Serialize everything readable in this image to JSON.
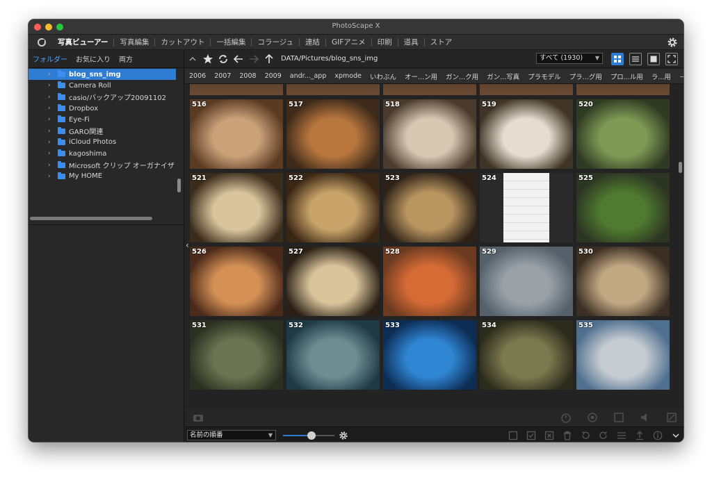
{
  "window": {
    "title": "PhotoScape X"
  },
  "menu": {
    "items": [
      "写真ビューアー",
      "写真編集",
      "カットアウト",
      "一括編集",
      "コラージュ",
      "連結",
      "GIFアニメ",
      "印刷",
      "道具",
      "ストア"
    ],
    "active_index": 0
  },
  "sidebar": {
    "tabs": [
      "フォルダー",
      "お気に入り",
      "両方"
    ],
    "active_tab": 0,
    "tree": [
      {
        "label": "blog_sns_img",
        "selected": true
      },
      {
        "label": "Camera Roll"
      },
      {
        "label": "casio/バックアップ20091102"
      },
      {
        "label": "Dropbox"
      },
      {
        "label": "Eye-Fi"
      },
      {
        "label": "GARO関連"
      },
      {
        "label": "iCloud Photos"
      },
      {
        "label": "kagoshima"
      },
      {
        "label": "Microsoft クリップ オーガナイザ"
      },
      {
        "label": "My HOME"
      }
    ]
  },
  "toolbar": {
    "path": "DATA/Pictures/blog_sns_img",
    "filter_value": "すべて (1930)"
  },
  "folder_bar": [
    "2006",
    "2007",
    "2008",
    "2009",
    "andr..._app",
    "xpmode",
    "いわぶん",
    "オー...ン用",
    "ガン...ク用",
    "ガン...写真",
    "プラモデル",
    "プラ...グ用",
    "プロ...ル用",
    "ラ...用",
    "－"
  ],
  "thumbnails": [
    {
      "num": "516"
    },
    {
      "num": "517"
    },
    {
      "num": "518"
    },
    {
      "num": "519"
    },
    {
      "num": "520"
    },
    {
      "num": "521"
    },
    {
      "num": "522"
    },
    {
      "num": "523"
    },
    {
      "num": "524"
    },
    {
      "num": "525"
    },
    {
      "num": "526"
    },
    {
      "num": "527"
    },
    {
      "num": "528"
    },
    {
      "num": "529"
    },
    {
      "num": "530"
    },
    {
      "num": "531"
    },
    {
      "num": "532"
    },
    {
      "num": "533"
    },
    {
      "num": "534"
    },
    {
      "num": "535"
    }
  ],
  "status": {
    "sort_value": "名前の順番",
    "zoom_fraction": 0.55
  },
  "colors": {
    "accent": "#2f7cd3",
    "folder": "#3b8ef0"
  }
}
